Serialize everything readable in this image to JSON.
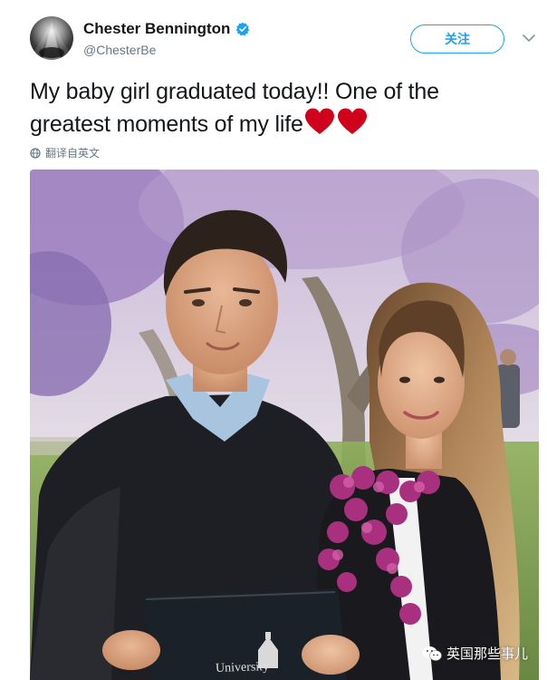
{
  "user": {
    "display_name": "Chester Bennington",
    "handle": "@ChesterBe",
    "verified": true,
    "avatar_icon": "profile-avatar-icon"
  },
  "actions": {
    "follow_label": "关注",
    "more_icon": "chevron-down-icon"
  },
  "tweet": {
    "text": "My baby girl graduated today!! One of the greatest moments of my life",
    "emoji": [
      "red-heart",
      "red-heart"
    ],
    "translate_label": "翻译自英文",
    "translate_icon": "globe-icon"
  },
  "media": {
    "photo_icon": "graduation-photo",
    "diploma_text": "University"
  },
  "watermark": {
    "text": "英国那些事儿",
    "icon": "wechat-icon"
  },
  "colors": {
    "accent": "#1da1f2",
    "text": "#14171a",
    "secondary": "#657786",
    "heart": "#d0021b"
  }
}
